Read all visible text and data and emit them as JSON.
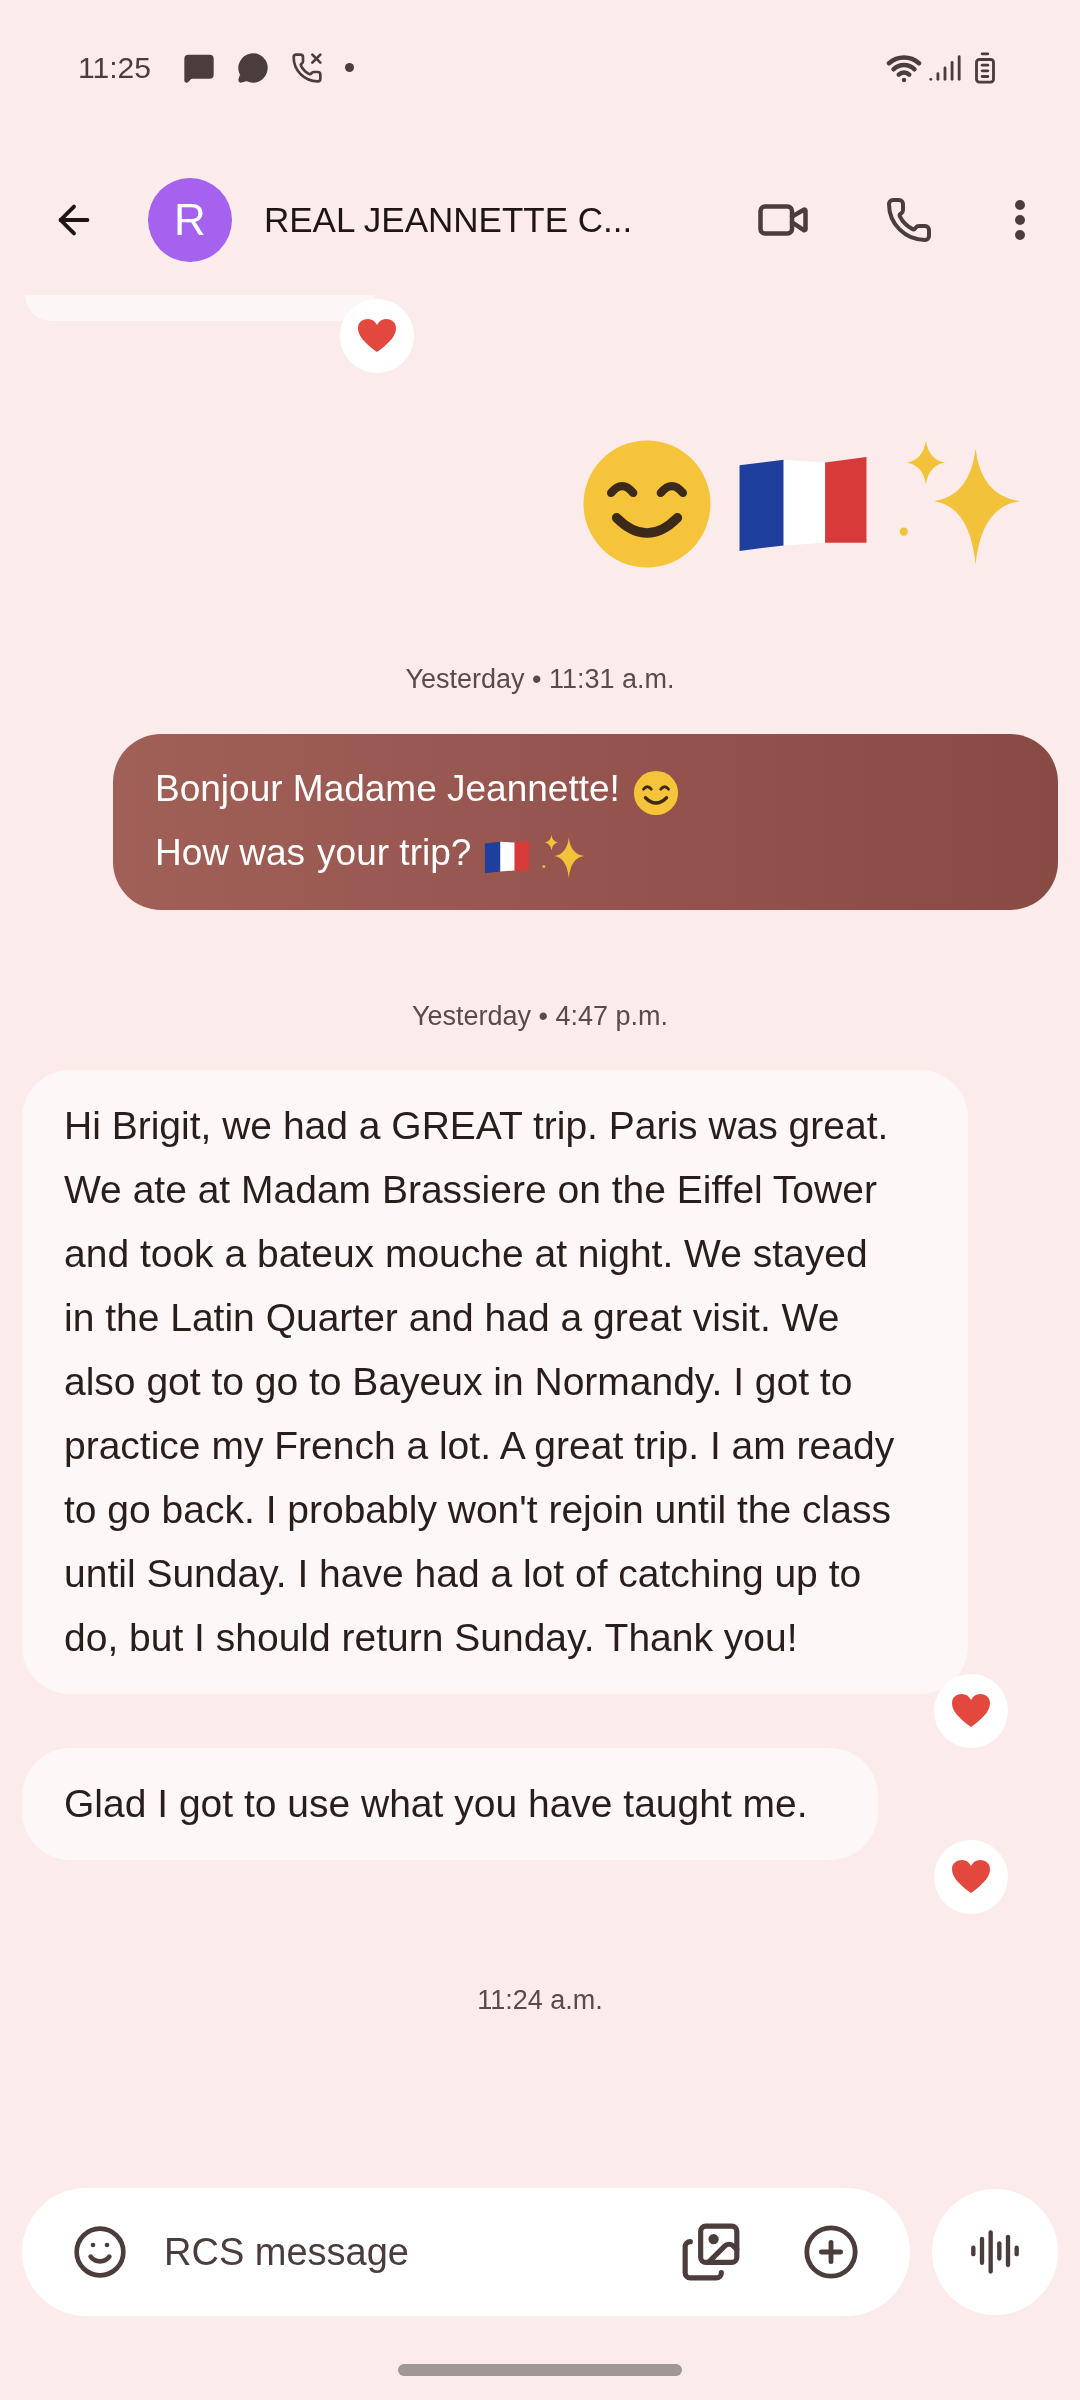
{
  "status_bar": {
    "time": "11:25"
  },
  "header": {
    "avatar_letter": "R",
    "contact_name": "REAL JEANNETTE C..."
  },
  "messages": [
    {
      "kind": "partial_received",
      "reacted": true
    },
    {
      "kind": "emoji_sent",
      "parts": [
        {
          "kind": "smile"
        },
        {
          "kind": "flag"
        },
        {
          "kind": "sparkles"
        }
      ]
    },
    {
      "kind": "timestamp",
      "text": "Yesterday • 11:31 a.m."
    },
    {
      "kind": "sent",
      "parts": [
        {
          "kind": "text",
          "text": "Bonjour Madame Jeannette!"
        },
        {
          "kind": "smile"
        },
        {
          "kind": "text",
          "text": "How was"
        },
        {
          "kind": "text",
          "text": "your trip?"
        },
        {
          "kind": "flag"
        },
        {
          "kind": "sparkles"
        }
      ]
    },
    {
      "kind": "timestamp",
      "text": "Yesterday • 4:47 p.m."
    },
    {
      "kind": "received",
      "reacted": true,
      "parts": [
        {
          "kind": "text",
          "text": "Hi Brigit, we had a GREAT trip. Paris was great. We ate at Madam Brassiere on the Eiffel Tower and took a bateux mouche at night. We stayed in the Latin Quarter and had a great visit. We also got to go to Bayeux in Normandy. I got to practice my French a lot. A great trip. I am ready to go back. I probably won't rejoin until the class until  Sunday. I have had a lot of catching up to do, but I should return Sunday. Thank you!"
        }
      ]
    },
    {
      "kind": "received",
      "reacted": true,
      "parts": [
        {
          "kind": "text",
          "text": "Glad I got to use what you have taught me."
        }
      ]
    },
    {
      "kind": "timestamp",
      "text": "11:24 a.m."
    }
  ],
  "composer": {
    "placeholder": "RCS message"
  }
}
